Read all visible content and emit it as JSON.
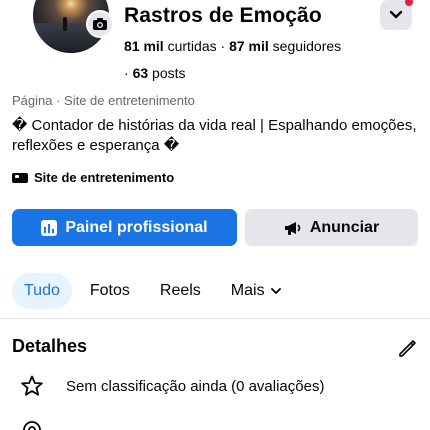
{
  "profile": {
    "name": "Rastros de Emoção",
    "likes_value": "81 mil",
    "likes_label": "curtidas",
    "separator": "·",
    "followers_value": "87 mil",
    "followers_label": "seguidores",
    "posts_value": "63",
    "posts_label": "posts",
    "category": "Página · Site de entretenimento",
    "bio": "� Contador de histórias da vida real | Espalhando emoções, reflexões e esperança �",
    "tag": "Site de entretenimento"
  },
  "actions": {
    "primary_label": "Painel profissional",
    "secondary_label": "Anunciar"
  },
  "tabs": [
    {
      "label": "Tudo",
      "active": true
    },
    {
      "label": "Fotos",
      "active": false
    },
    {
      "label": "Reels",
      "active": false
    },
    {
      "label": "Mais",
      "active": false
    }
  ],
  "details": {
    "title": "Detalhes",
    "rating_text": "Sem classificação ainda (0 avaliações)"
  },
  "icons": {
    "camera": "camera-icon",
    "chevron": "chevron-down-icon",
    "dashboard": "dashboard-chart-icon",
    "megaphone": "megaphone-icon",
    "pencil": "pencil-icon",
    "star": "star-icon",
    "pin": "location-pin-icon"
  },
  "colors": {
    "accent": "#1b74e4",
    "notification": "#e41e3f",
    "secondary_bg": "#e4e6eb",
    "muted_text": "#65676b"
  }
}
